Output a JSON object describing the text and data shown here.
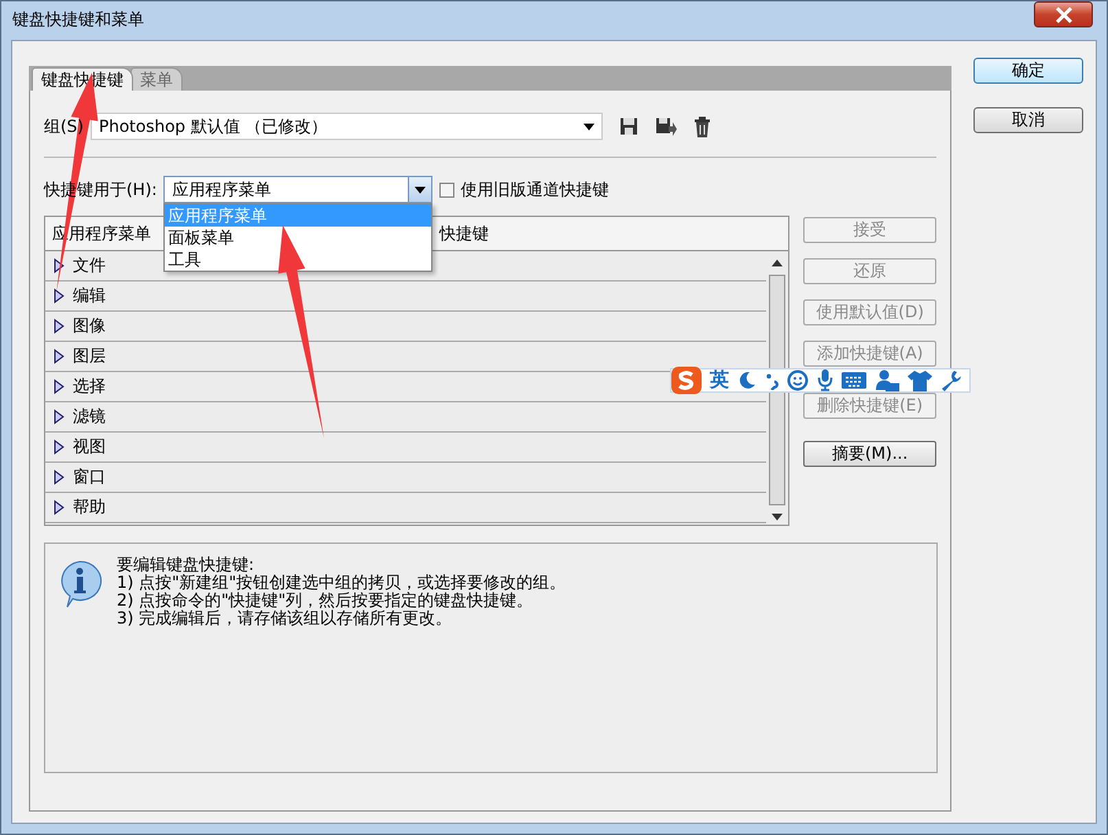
{
  "window": {
    "title": "键盘快捷键和菜单"
  },
  "tabs": [
    {
      "label": "键盘快捷键",
      "selected": true
    },
    {
      "label": "菜单",
      "selected": false
    }
  ],
  "group": {
    "label": "组(S)",
    "value": "Photoshop 默认值 （已修改）"
  },
  "shortcuts_for": {
    "label": "快捷键用于(H):",
    "value": "应用程序菜单",
    "expanded": true,
    "options": [
      {
        "label": "应用程序菜单",
        "selected": true
      },
      {
        "label": "面板菜单",
        "selected": false
      },
      {
        "label": "工具",
        "selected": false
      }
    ]
  },
  "legacy_channel": {
    "label": "使用旧版通道快捷键",
    "checked": false
  },
  "table": {
    "columns": [
      "应用程序菜单",
      "快捷键"
    ],
    "rows": [
      {
        "label": "文件",
        "expanded": false
      },
      {
        "label": "编辑",
        "expanded": false
      },
      {
        "label": "图像",
        "expanded": false
      },
      {
        "label": "图层",
        "expanded": false
      },
      {
        "label": "选择",
        "expanded": false
      },
      {
        "label": "滤镜",
        "expanded": false
      },
      {
        "label": "视图",
        "expanded": false
      },
      {
        "label": "窗口",
        "expanded": false
      },
      {
        "label": "帮助",
        "expanded": false
      }
    ]
  },
  "side_buttons": [
    {
      "label": "接受",
      "disabled": true
    },
    {
      "label": "还原",
      "disabled": true
    },
    {
      "label": "使用默认值(D)",
      "disabled": true
    },
    {
      "label": "添加快捷键(A)",
      "disabled": true
    },
    {
      "label": "删除快捷键(E)",
      "disabled": true
    },
    {
      "label": "摘要(M)...",
      "disabled": false
    }
  ],
  "info": {
    "lines": [
      "要编辑键盘快捷键:",
      "1) 点按\"新建组\"按钮创建选中组的拷贝，或选择要修改的组。",
      "2) 点按命令的\"快捷键\"列，然后按要指定的键盘快捷键。",
      "3) 完成编辑后，请存储该组以存储所有更改。"
    ]
  },
  "dialog_buttons": [
    {
      "label": "确定",
      "default": true
    },
    {
      "label": "取消",
      "default": false
    }
  ],
  "ime_toolbar": {
    "mode": "英"
  },
  "annotations": [
    {
      "kind": "arrow"
    },
    {
      "kind": "arrow"
    }
  ]
}
